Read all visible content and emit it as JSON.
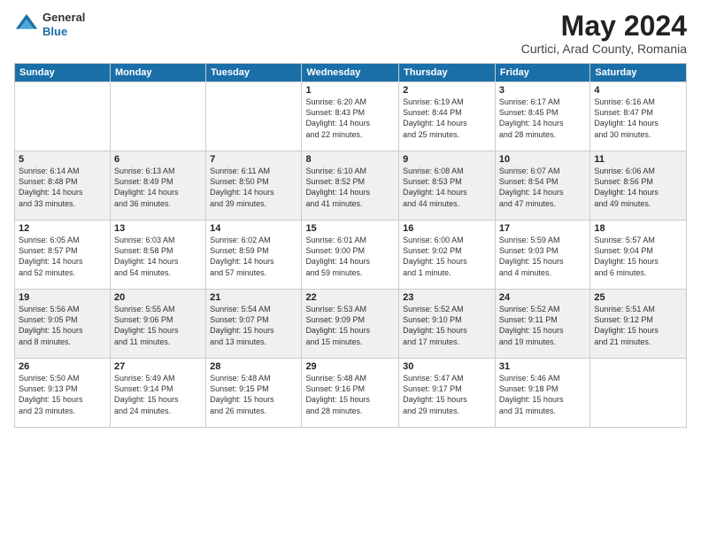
{
  "header": {
    "logo_general": "General",
    "logo_blue": "Blue",
    "month_title": "May 2024",
    "subtitle": "Curtici, Arad County, Romania"
  },
  "days_of_week": [
    "Sunday",
    "Monday",
    "Tuesday",
    "Wednesday",
    "Thursday",
    "Friday",
    "Saturday"
  ],
  "weeks": [
    [
      {
        "day": "",
        "info": ""
      },
      {
        "day": "",
        "info": ""
      },
      {
        "day": "",
        "info": ""
      },
      {
        "day": "1",
        "info": "Sunrise: 6:20 AM\nSunset: 8:43 PM\nDaylight: 14 hours\nand 22 minutes."
      },
      {
        "day": "2",
        "info": "Sunrise: 6:19 AM\nSunset: 8:44 PM\nDaylight: 14 hours\nand 25 minutes."
      },
      {
        "day": "3",
        "info": "Sunrise: 6:17 AM\nSunset: 8:45 PM\nDaylight: 14 hours\nand 28 minutes."
      },
      {
        "day": "4",
        "info": "Sunrise: 6:16 AM\nSunset: 8:47 PM\nDaylight: 14 hours\nand 30 minutes."
      }
    ],
    [
      {
        "day": "5",
        "info": "Sunrise: 6:14 AM\nSunset: 8:48 PM\nDaylight: 14 hours\nand 33 minutes."
      },
      {
        "day": "6",
        "info": "Sunrise: 6:13 AM\nSunset: 8:49 PM\nDaylight: 14 hours\nand 36 minutes."
      },
      {
        "day": "7",
        "info": "Sunrise: 6:11 AM\nSunset: 8:50 PM\nDaylight: 14 hours\nand 39 minutes."
      },
      {
        "day": "8",
        "info": "Sunrise: 6:10 AM\nSunset: 8:52 PM\nDaylight: 14 hours\nand 41 minutes."
      },
      {
        "day": "9",
        "info": "Sunrise: 6:08 AM\nSunset: 8:53 PM\nDaylight: 14 hours\nand 44 minutes."
      },
      {
        "day": "10",
        "info": "Sunrise: 6:07 AM\nSunset: 8:54 PM\nDaylight: 14 hours\nand 47 minutes."
      },
      {
        "day": "11",
        "info": "Sunrise: 6:06 AM\nSunset: 8:56 PM\nDaylight: 14 hours\nand 49 minutes."
      }
    ],
    [
      {
        "day": "12",
        "info": "Sunrise: 6:05 AM\nSunset: 8:57 PM\nDaylight: 14 hours\nand 52 minutes."
      },
      {
        "day": "13",
        "info": "Sunrise: 6:03 AM\nSunset: 8:58 PM\nDaylight: 14 hours\nand 54 minutes."
      },
      {
        "day": "14",
        "info": "Sunrise: 6:02 AM\nSunset: 8:59 PM\nDaylight: 14 hours\nand 57 minutes."
      },
      {
        "day": "15",
        "info": "Sunrise: 6:01 AM\nSunset: 9:00 PM\nDaylight: 14 hours\nand 59 minutes."
      },
      {
        "day": "16",
        "info": "Sunrise: 6:00 AM\nSunset: 9:02 PM\nDaylight: 15 hours\nand 1 minute."
      },
      {
        "day": "17",
        "info": "Sunrise: 5:59 AM\nSunset: 9:03 PM\nDaylight: 15 hours\nand 4 minutes."
      },
      {
        "day": "18",
        "info": "Sunrise: 5:57 AM\nSunset: 9:04 PM\nDaylight: 15 hours\nand 6 minutes."
      }
    ],
    [
      {
        "day": "19",
        "info": "Sunrise: 5:56 AM\nSunset: 9:05 PM\nDaylight: 15 hours\nand 8 minutes."
      },
      {
        "day": "20",
        "info": "Sunrise: 5:55 AM\nSunset: 9:06 PM\nDaylight: 15 hours\nand 11 minutes."
      },
      {
        "day": "21",
        "info": "Sunrise: 5:54 AM\nSunset: 9:07 PM\nDaylight: 15 hours\nand 13 minutes."
      },
      {
        "day": "22",
        "info": "Sunrise: 5:53 AM\nSunset: 9:09 PM\nDaylight: 15 hours\nand 15 minutes."
      },
      {
        "day": "23",
        "info": "Sunrise: 5:52 AM\nSunset: 9:10 PM\nDaylight: 15 hours\nand 17 minutes."
      },
      {
        "day": "24",
        "info": "Sunrise: 5:52 AM\nSunset: 9:11 PM\nDaylight: 15 hours\nand 19 minutes."
      },
      {
        "day": "25",
        "info": "Sunrise: 5:51 AM\nSunset: 9:12 PM\nDaylight: 15 hours\nand 21 minutes."
      }
    ],
    [
      {
        "day": "26",
        "info": "Sunrise: 5:50 AM\nSunset: 9:13 PM\nDaylight: 15 hours\nand 23 minutes."
      },
      {
        "day": "27",
        "info": "Sunrise: 5:49 AM\nSunset: 9:14 PM\nDaylight: 15 hours\nand 24 minutes."
      },
      {
        "day": "28",
        "info": "Sunrise: 5:48 AM\nSunset: 9:15 PM\nDaylight: 15 hours\nand 26 minutes."
      },
      {
        "day": "29",
        "info": "Sunrise: 5:48 AM\nSunset: 9:16 PM\nDaylight: 15 hours\nand 28 minutes."
      },
      {
        "day": "30",
        "info": "Sunrise: 5:47 AM\nSunset: 9:17 PM\nDaylight: 15 hours\nand 29 minutes."
      },
      {
        "day": "31",
        "info": "Sunrise: 5:46 AM\nSunset: 9:18 PM\nDaylight: 15 hours\nand 31 minutes."
      },
      {
        "day": "",
        "info": ""
      }
    ]
  ]
}
